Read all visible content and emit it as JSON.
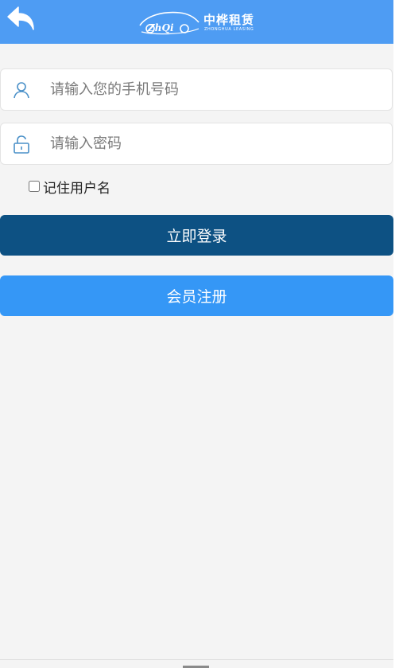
{
  "header": {
    "back_icon": "back-arrow-icon",
    "logo": {
      "mark": "ZhQi",
      "name": "中桦租赁",
      "sub": "ZHONGHUA LEASING"
    },
    "background": "#4e9cf3"
  },
  "form": {
    "phone": {
      "icon": "user-icon",
      "placeholder": "请输入您的手机号码",
      "value": ""
    },
    "password": {
      "icon": "lock-icon",
      "placeholder": "请输入密码",
      "value": ""
    },
    "remember": {
      "label": "记住用户名",
      "checked": false
    }
  },
  "buttons": {
    "login": {
      "label": "立即登录",
      "color": "#0d5183"
    },
    "register": {
      "label": "会员注册",
      "color": "#3597f6"
    }
  },
  "colors": {
    "page_bg": "#f4f4f4",
    "icon": "#4a90c8"
  }
}
